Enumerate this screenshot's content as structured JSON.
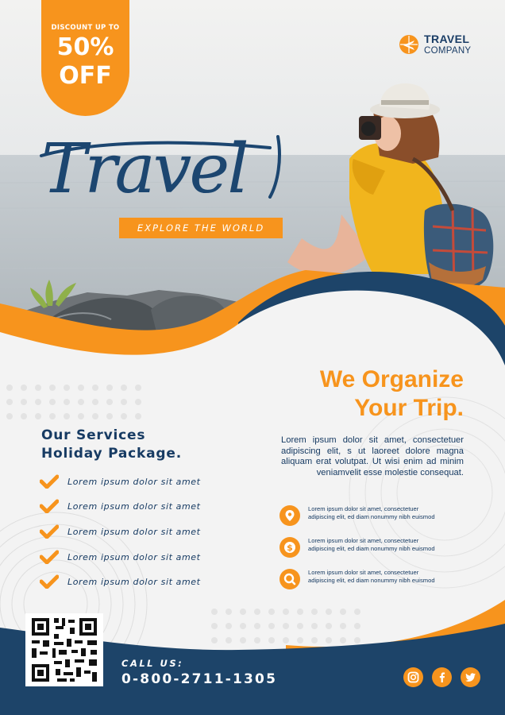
{
  "badge": {
    "line1": "DISCOUNT UP TO",
    "line2": "50%",
    "line3": "OFF"
  },
  "brand": {
    "line1": "TRAVEL",
    "line2": "COMPANY",
    "icon": "plane-globe-icon"
  },
  "hero": {
    "script_title": "Travel",
    "tagline": "EXPLORE THE WORLD"
  },
  "organize": {
    "heading_line1": "We Organize",
    "heading_line2": "Your Trip.",
    "paragraph": "Lorem ipsum dolor sit amet, consectetuer adipiscing elit, s ut laoreet dolore magna aliquam erat volutpat. Ut wisi enim ad minim veniamvelit esse molestie consequat."
  },
  "services": {
    "title_line1": "Our Services",
    "title_line2": "Holiday Package.",
    "items": [
      "Lorem ipsum dolor sit amet",
      "Lorem ipsum dolor sit amet",
      "Lorem ipsum dolor sit amet",
      "Lorem ipsum dolor sit amet",
      "Lorem ipsum dolor sit amet"
    ]
  },
  "info": [
    {
      "icon": "location-pin-icon",
      "line1": "Lorem ipsum dolor sit amet, consectetuer",
      "line2": "adipiscing elit, ed diam nonummy nibh euismod"
    },
    {
      "icon": "dollar-icon",
      "line1": "Lorem ipsum dolor sit amet, consectetuer",
      "line2": "adipiscing elit, ed diam nonummy nibh euismod"
    },
    {
      "icon": "search-icon",
      "line1": "Lorem ipsum dolor sit amet, consectetuer",
      "line2": "adipiscing elit, ed diam nonummy nibh euismod"
    }
  ],
  "contact": {
    "label": "CALL US:",
    "phone": "0-800-2711-1305"
  },
  "social": [
    "instagram-icon",
    "facebook-icon",
    "twitter-icon"
  ],
  "colors": {
    "orange": "#f7941d",
    "navy": "#173b63",
    "background": "#f3f3f3"
  }
}
